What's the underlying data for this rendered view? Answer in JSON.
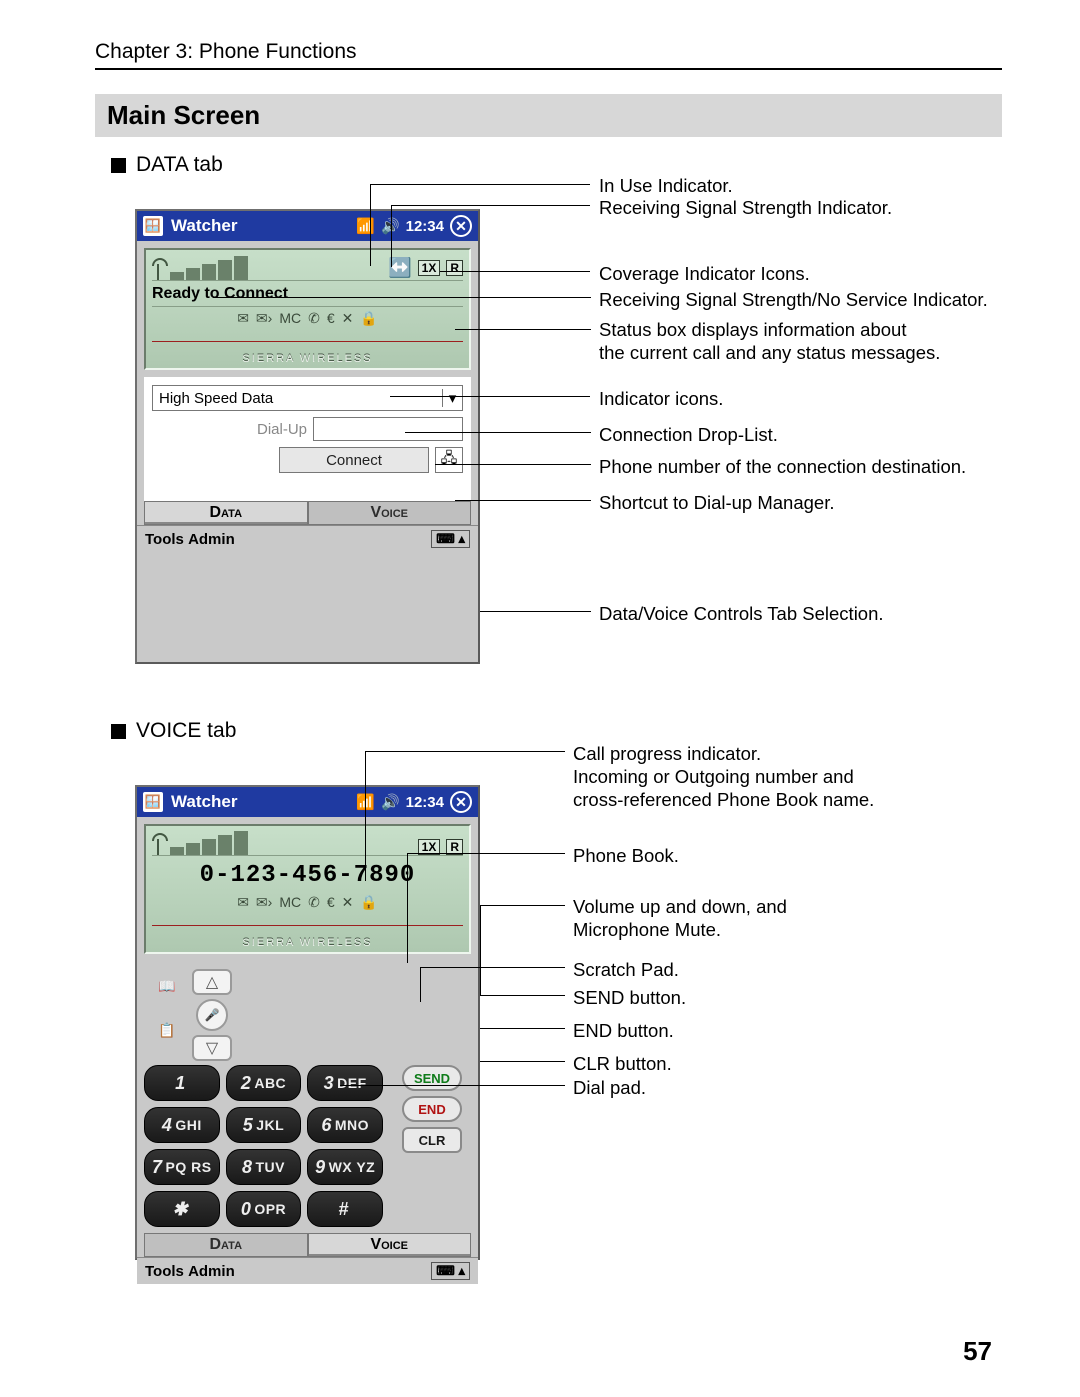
{
  "chapter": "Chapter 3: Phone Functions",
  "section": "Main Screen",
  "page_number": "57",
  "sub_data": "DATA tab",
  "sub_voice": "VOICE tab",
  "device": {
    "title": "Watcher",
    "time": "12:34",
    "status_text": "Ready to Connect",
    "brand": "SIERRA WIRELESS",
    "combo_text": "High Speed Data",
    "dialup_label": "Dial-Up",
    "connect_label": "Connect",
    "tab_data": "Data",
    "tab_voice": "Voice",
    "menu_tools": "Tools",
    "menu_admin": "Admin",
    "coverage_1x": "1X",
    "coverage_r": "R",
    "voice_number": "0-123-456-7890",
    "keys": {
      "k1": {
        "n": "1",
        "l": ""
      },
      "k2": {
        "n": "2",
        "l": "ABC"
      },
      "k3": {
        "n": "3",
        "l": "DEF"
      },
      "k4": {
        "n": "4",
        "l": "GHI"
      },
      "k5": {
        "n": "5",
        "l": "JKL"
      },
      "k6": {
        "n": "6",
        "l": "MNO"
      },
      "k7": {
        "n": "7",
        "l": "PQ RS"
      },
      "k8": {
        "n": "8",
        "l": "TUV"
      },
      "k9": {
        "n": "9",
        "l": "WX YZ"
      },
      "kstar": {
        "n": "✱",
        "l": ""
      },
      "k0": {
        "n": "0",
        "l": "OPR"
      },
      "khash": {
        "n": "#",
        "l": ""
      }
    },
    "send": "SEND",
    "end": "END",
    "clr": "CLR"
  },
  "callouts_data": {
    "c1": "In Use Indicator.",
    "c2": "Receiving Signal Strength Indicator.",
    "c3": "Coverage Indicator Icons.",
    "c4": "Receiving Signal Strength/No Service Indicator.",
    "c5": "Status box displays information about\nthe current call and any status messages.",
    "c6": "Indicator icons.",
    "c7": "Connection Drop-List.",
    "c8": "Phone number of the connection destination.",
    "c9": "Shortcut to Dial-up Manager.",
    "c10": "Data/Voice Controls Tab Selection."
  },
  "callouts_voice": {
    "v1": "Call progress indicator.\nIncoming or Outgoing number and\ncross-referenced Phone Book name.",
    "v2": "Phone Book.",
    "v3": "Volume up and down, and\nMicrophone Mute.",
    "v4": "Scratch Pad.",
    "v5": "SEND button.",
    "v6": "END button.",
    "v7": "CLR button.",
    "v8": "Dial pad."
  }
}
